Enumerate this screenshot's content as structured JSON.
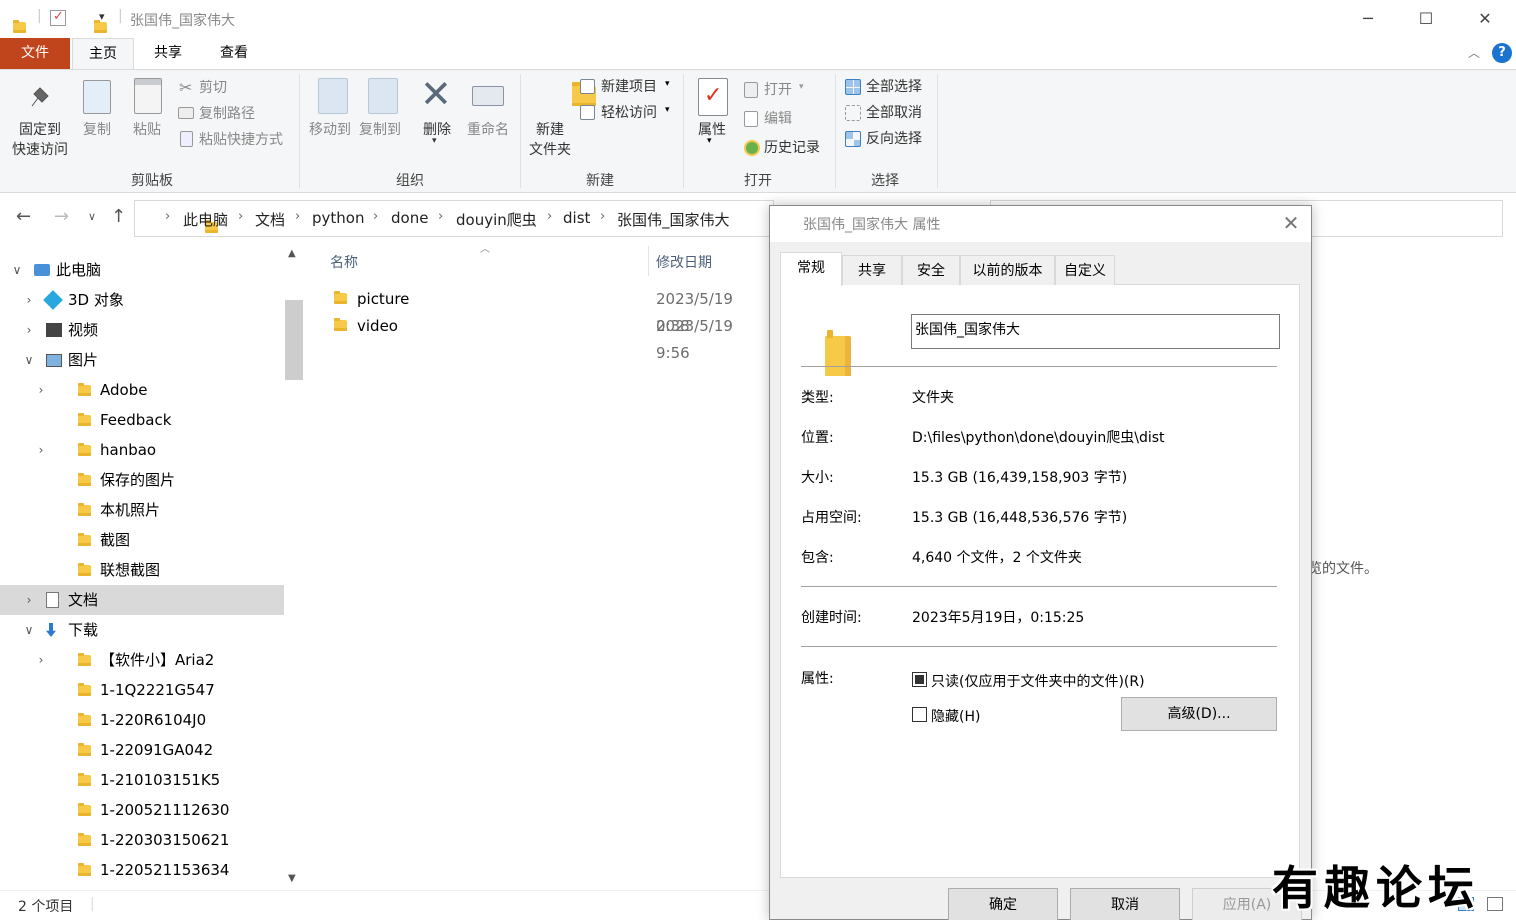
{
  "window": {
    "title": "张国伟_国家伟大"
  },
  "ribbon_tabs": [
    "文件",
    "主页",
    "共享",
    "查看"
  ],
  "ribbon": {
    "clipboard": {
      "pin": "固定到\n快速访问",
      "copy": "复制",
      "paste": "粘贴",
      "cut": "剪切",
      "copy_path": "复制路径",
      "paste_shortcut": "粘贴快捷方式",
      "group": "剪贴板"
    },
    "organize": {
      "move_to": "移动到",
      "copy_to": "复制到",
      "delete": "删除",
      "rename": "重命名",
      "group": "组织"
    },
    "new": {
      "new_item": "新建项目",
      "easy_access": "轻松访问",
      "new_folder": "新建\n文件夹",
      "group": "新建"
    },
    "open": {
      "properties": "属性",
      "open": "打开",
      "edit": "编辑",
      "history": "历史记录",
      "group": "打开"
    },
    "select": {
      "select_all": "全部选择",
      "select_none": "全部取消",
      "invert": "反向选择",
      "group": "选择"
    }
  },
  "address": {
    "crumbs": [
      "此电脑",
      "文档",
      "python",
      "done",
      "douyin爬虫",
      "dist",
      "张国伟_国家伟大"
    ]
  },
  "nav": [
    {
      "label": "此电脑",
      "icon": "pc-icon",
      "indent": 0,
      "expand": "v"
    },
    {
      "label": "3D 对象",
      "icon": "3d-objects-icon",
      "indent": 1,
      "expand": ">"
    },
    {
      "label": "视频",
      "icon": "video-icon",
      "indent": 1,
      "expand": ">"
    },
    {
      "label": "图片",
      "icon": "pictures-icon",
      "indent": 1,
      "expand": "v"
    },
    {
      "label": "Adobe",
      "icon": "folder-icon",
      "indent": 2,
      "expand": ">"
    },
    {
      "label": "Feedback",
      "icon": "folder-icon",
      "indent": 2,
      "expand": ""
    },
    {
      "label": "hanbao",
      "icon": "folder-icon",
      "indent": 2,
      "expand": ">"
    },
    {
      "label": "保存的图片",
      "icon": "folder-icon",
      "indent": 2,
      "expand": ""
    },
    {
      "label": "本机照片",
      "icon": "folder-icon",
      "indent": 2,
      "expand": ""
    },
    {
      "label": "截图",
      "icon": "folder-icon",
      "indent": 2,
      "expand": ""
    },
    {
      "label": "联想截图",
      "icon": "folder-icon",
      "indent": 2,
      "expand": ""
    },
    {
      "label": "文档",
      "icon": "documents-icon",
      "indent": 1,
      "expand": ">",
      "state": "hover"
    },
    {
      "label": "下载",
      "icon": "download-icon",
      "indent": 1,
      "expand": "v"
    },
    {
      "label": "【软件小】Aria2",
      "icon": "folder-icon",
      "indent": 2,
      "expand": ">"
    },
    {
      "label": "1-1Q2221G547",
      "icon": "folder-icon",
      "indent": 2,
      "expand": ""
    },
    {
      "label": "1-220R6104J0",
      "icon": "folder-icon",
      "indent": 2,
      "expand": ""
    },
    {
      "label": "1-22091GA042",
      "icon": "folder-icon",
      "indent": 2,
      "expand": ""
    },
    {
      "label": "1-210103151K5",
      "icon": "folder-icon",
      "indent": 2,
      "expand": ""
    },
    {
      "label": "1-200521112630",
      "icon": "folder-icon",
      "indent": 2,
      "expand": ""
    },
    {
      "label": "1-220303150621",
      "icon": "folder-icon",
      "indent": 2,
      "expand": ""
    },
    {
      "label": "1-220521153634",
      "icon": "folder-icon",
      "indent": 2,
      "expand": ""
    }
  ],
  "filelist": {
    "columns": {
      "name": "名称",
      "modified": "修改日期"
    },
    "rows": [
      {
        "name": "picture",
        "date": "2023/5/19 0:38"
      },
      {
        "name": "video",
        "date": "2023/5/19 9:56"
      }
    ]
  },
  "preview_hint": "要预览的文件。",
  "status": {
    "count": "2 个项目"
  },
  "dialog": {
    "title": "张国伟_国家伟大 属性",
    "tabs": [
      "常规",
      "共享",
      "安全",
      "以前的版本",
      "自定义"
    ],
    "name_value": "张国伟_国家伟大",
    "type_label": "类型:",
    "type_value": "文件夹",
    "location_label": "位置:",
    "location_value": "D:\\files\\python\\done\\douyin爬虫\\dist",
    "size_label": "大小:",
    "size_value": "15.3 GB (16,439,158,903 字节)",
    "disk_label": "占用空间:",
    "disk_value": "15.3 GB (16,448,536,576 字节)",
    "contains_label": "包含:",
    "contains_value": "4,640 个文件，2 个文件夹",
    "created_label": "创建时间:",
    "created_value": "2023年5月19日，0:15:25",
    "attrs_label": "属性:",
    "readonly_label": "只读(仅应用于文件夹中的文件)(R)",
    "hidden_label": "隐藏(H)",
    "advanced_label": "高级(D)...",
    "ok_label": "确定",
    "cancel_label": "取消",
    "apply_label": "应用(A)"
  },
  "watermark": "有趣论坛"
}
